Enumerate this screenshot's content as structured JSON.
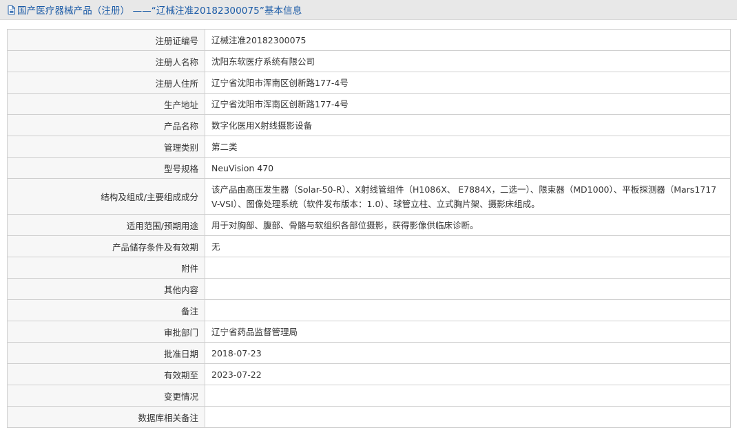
{
  "page": {
    "title": "国产医疗器械产品（注册） ——“辽械注准20182300075”基本信息",
    "title_icon": "document-icon"
  },
  "colors": {
    "title_text": "#1a5aa6",
    "title_bar_bg": "#e8e8e8",
    "label_bg": "#f7f7f7",
    "border": "#cfcfcf"
  },
  "rows": [
    {
      "label": "注册证编号",
      "value": "辽械注准20182300075"
    },
    {
      "label": "注册人名称",
      "value": "沈阳东软医疗系统有限公司"
    },
    {
      "label": "注册人住所",
      "value": "辽宁省沈阳市浑南区创新路177-4号"
    },
    {
      "label": "生产地址",
      "value": "辽宁省沈阳市浑南区创新路177-4号"
    },
    {
      "label": "产品名称",
      "value": "数字化医用X射线摄影设备"
    },
    {
      "label": "管理类别",
      "value": "第二类"
    },
    {
      "label": "型号规格",
      "value": "NeuVision 470"
    },
    {
      "label": "结构及组成/主要组成成分",
      "value": "该产品由高压发生器（Solar-50-R）、X射线管组件（H1086X、 E7884X，二选一）、限束器（MD1000）、平板探测器（Mars1717V-VSI）、图像处理系统（软件发布版本：1.0）、球管立柱、立式胸片架、摄影床组成。"
    },
    {
      "label": "适用范围/预期用途",
      "value": "用于对胸部、腹部、骨骼与软组织各部位摄影，获得影像供临床诊断。"
    },
    {
      "label": "产品储存条件及有效期",
      "value": "无"
    },
    {
      "label": "附件",
      "value": ""
    },
    {
      "label": "其他内容",
      "value": ""
    },
    {
      "label": "备注",
      "value": ""
    },
    {
      "label": "审批部门",
      "value": "辽宁省药品监督管理局"
    },
    {
      "label": "批准日期",
      "value": "2018-07-23"
    },
    {
      "label": "有效期至",
      "value": "2023-07-22"
    },
    {
      "label": "变更情况",
      "value": ""
    },
    {
      "label": "数据库相关备注",
      "value": ""
    }
  ]
}
